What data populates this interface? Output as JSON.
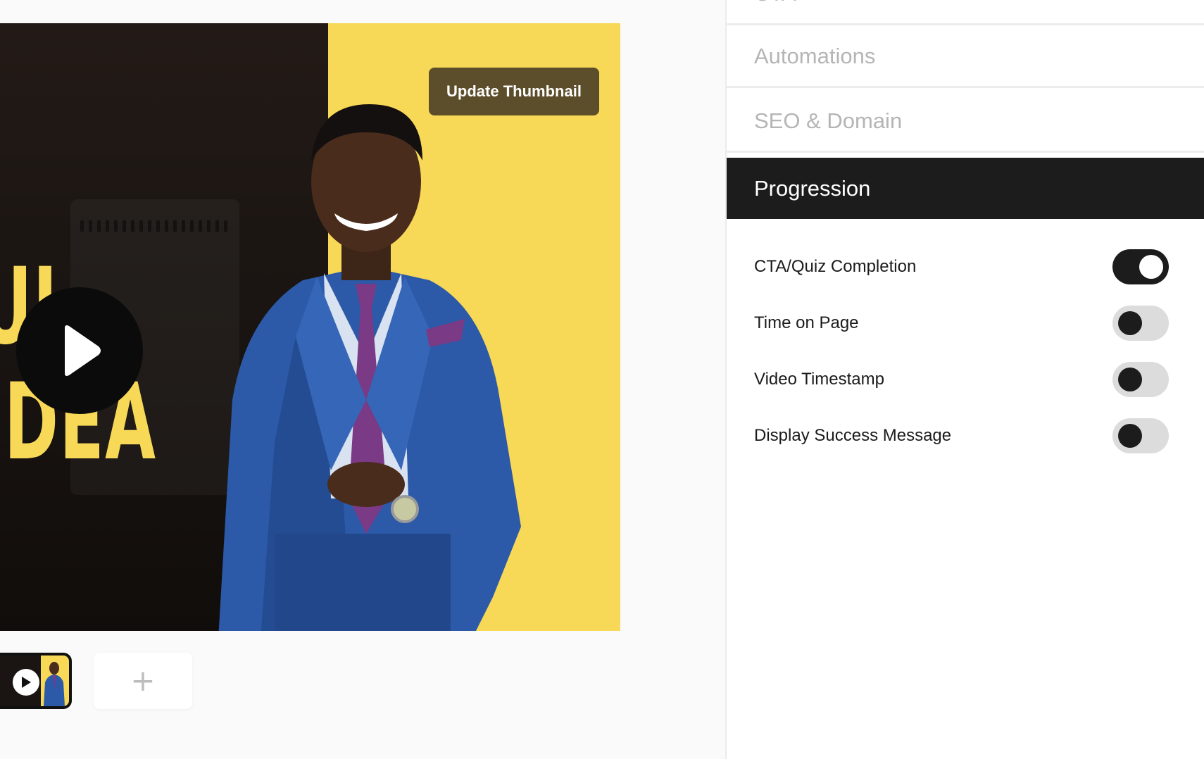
{
  "preview": {
    "update_thumbnail_label": "Update Thumbnail",
    "thumbnail_text_line1": "UI",
    "thumbnail_text_line2": "IDEA",
    "add_slot_symbol": "+",
    "icons": {
      "play": "play-icon",
      "add": "plus-icon"
    },
    "colors": {
      "thumbnail_yellow": "#f8d957",
      "button_brown": "#5d4e2b"
    }
  },
  "sidebar": {
    "items": [
      {
        "label": "CTA",
        "state": "collapsed"
      },
      {
        "label": "Automations",
        "state": "collapsed"
      },
      {
        "label": "SEO & Domain",
        "state": "collapsed"
      },
      {
        "label": "Progression",
        "state": "expanded"
      }
    ],
    "progression": {
      "options": [
        {
          "label": "CTA/Quiz  Completion",
          "enabled": true
        },
        {
          "label": "Time on Page",
          "enabled": false
        },
        {
          "label": "Video Timestamp",
          "enabled": false
        },
        {
          "label": "Display Success Message",
          "enabled": false
        }
      ]
    },
    "colors": {
      "active_bg": "#1c1c1d",
      "inactive_text": "#b5b5b5"
    }
  }
}
